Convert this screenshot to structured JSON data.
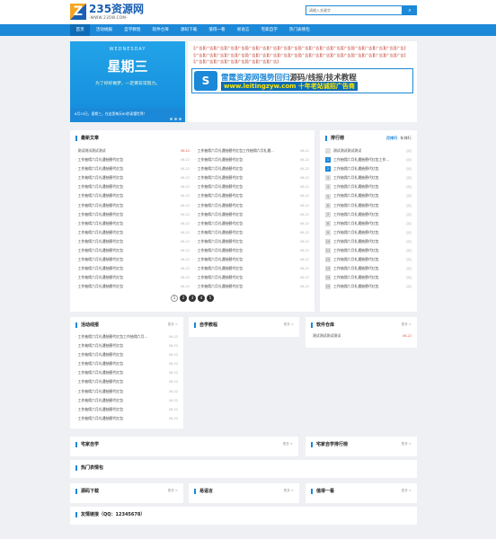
{
  "header": {
    "logo_mark": "Z",
    "logo_title": "235资源网",
    "logo_sub": "-WWW.235W.COM-",
    "search_placeholder": "请输入关键字",
    "search_icon": "search-icon",
    "search_glyph": "⌕"
  },
  "nav": [
    "首页",
    "活动线报",
    "自学教程",
    "软件仓库",
    "源码下载",
    "值得一看",
    "易语言",
    "宅家自学",
    "热门表情包"
  ],
  "hero": {
    "week_en": "WEDNESDAY",
    "day": "星期三",
    "tagline": "为了好好做梦，一定要非常努力。",
    "caption": "6月15日，星期三，在这里每天60秒读懂世界！"
  },
  "links": {
    "item": "【广告】",
    "count": 48
  },
  "ad": {
    "icon": "S",
    "line1_blue": "雷霆资源网强势回归",
    "line1_dark": "源码/线报/技术教程",
    "line2": "www.leitingzyw.com  十年老站诚招广告商"
  },
  "latest": {
    "title": "最新文章",
    "left": [
      {
        "t": "测试测试测试测试",
        "d": "06-22",
        "red": true
      },
      {
        "t": "工作抽佣六月礼遇抽替代红包",
        "d": "06-22"
      },
      {
        "t": "工作抽佣六月礼遇抽替代红包",
        "d": "06-22"
      },
      {
        "t": "工作抽佣六月礼遇抽替代红包",
        "d": "06-22"
      },
      {
        "t": "工作抽佣六月礼遇抽替代红包",
        "d": "06-22"
      },
      {
        "t": "工作抽佣六月礼遇抽替代红包",
        "d": "06-22"
      },
      {
        "t": "工作抽佣六月礼遇抽替代红包",
        "d": "06-22"
      },
      {
        "t": "工作抽佣六月礼遇抽替代红包",
        "d": "06-22"
      },
      {
        "t": "工作抽佣六月礼遇抽替代红包",
        "d": "06-22"
      },
      {
        "t": "工作抽佣六月礼遇抽替代红包",
        "d": "06-22"
      },
      {
        "t": "工作抽佣六月礼遇抽替代红包",
        "d": "06-22"
      },
      {
        "t": "工作抽佣六月礼遇抽替代红包",
        "d": "06-22"
      },
      {
        "t": "工作抽佣六月礼遇抽替代红包",
        "d": "06-22"
      },
      {
        "t": "工作抽佣六月礼遇抽替代红包",
        "d": "06-22"
      },
      {
        "t": "工作抽佣六月礼遇抽替代红包",
        "d": "06-22"
      },
      {
        "t": "工作抽佣六月礼遇抽替代红包",
        "d": "06-22"
      }
    ],
    "right": [
      {
        "t": "工作抽佣六月礼遇抽替代红包工作抽佣六月礼遇...",
        "d": "06-22"
      },
      {
        "t": "工作抽佣六月礼遇抽替代红包",
        "d": "06-22"
      },
      {
        "t": "工作抽佣六月礼遇抽替代红包",
        "d": "06-22"
      },
      {
        "t": "工作抽佣六月礼遇抽替代红包",
        "d": "06-22"
      },
      {
        "t": "工作抽佣六月礼遇抽替代红包",
        "d": "06-22"
      },
      {
        "t": "工作抽佣六月礼遇抽替代红包",
        "d": "06-22"
      },
      {
        "t": "工作抽佣六月礼遇抽替代红包",
        "d": "06-22"
      },
      {
        "t": "工作抽佣六月礼遇抽替代红包",
        "d": "06-22"
      },
      {
        "t": "工作抽佣六月礼遇抽替代红包",
        "d": "06-22"
      },
      {
        "t": "工作抽佣六月礼遇抽替代红包",
        "d": "06-22"
      },
      {
        "t": "工作抽佣六月礼遇抽替代红包",
        "d": "06-22"
      },
      {
        "t": "工作抽佣六月礼遇抽替代红包",
        "d": "06-22"
      },
      {
        "t": "工作抽佣六月礼遇抽替代红包",
        "d": "06-22"
      },
      {
        "t": "工作抽佣六月礼遇抽替代红包",
        "d": "06-22"
      },
      {
        "t": "工作抽佣六月礼遇抽替代红包",
        "d": "06-22"
      },
      {
        "t": "工作抽佣六月礼遇抽替代红包",
        "d": "06-22"
      }
    ],
    "pages": [
      "1",
      "2",
      "3",
      "4",
      "5"
    ]
  },
  "rank": {
    "title": "排行榜",
    "tabs": [
      "月排行",
      "年排行"
    ],
    "items": [
      "测试测试测试测试",
      "工作抽佣六月礼遇抽替代红包工作...",
      "工作抽佣六月礼遇抽替代红包",
      "工作抽佣六月礼遇抽替代红包",
      "工作抽佣六月礼遇抽替代红包",
      "工作抽佣六月礼遇抽替代红包",
      "工作抽佣六月礼遇抽替代红包",
      "工作抽佣六月礼遇抽替代红包",
      "工作抽佣六月礼遇抽替代红包",
      "工作抽佣六月礼遇抽替代红包",
      "工作抽佣六月礼遇抽替代红包",
      "工作抽佣六月礼遇抽替代红包",
      "工作抽佣六月礼遇抽替代红包",
      "工作抽佣六月礼遇抽替代红包",
      "工作抽佣六月礼遇抽替代红包",
      "工作抽佣六月礼遇抽替代红包"
    ],
    "tail": "[阅]"
  },
  "activity": {
    "title": "活动线报",
    "more": "更多 >",
    "items": [
      {
        "t": "工作抽佣六月礼遇抽替代红包工作抽佣六月...",
        "d": "06-22"
      },
      {
        "t": "工作抽佣六月礼遇抽替代红包",
        "d": "06-22"
      },
      {
        "t": "工作抽佣六月礼遇抽替代红包",
        "d": "06-22"
      },
      {
        "t": "工作抽佣六月礼遇抽替代红包",
        "d": "06-22"
      },
      {
        "t": "工作抽佣六月礼遇抽替代红包",
        "d": "06-22"
      },
      {
        "t": "工作抽佣六月礼遇抽替代红包",
        "d": "06-22"
      },
      {
        "t": "工作抽佣六月礼遇抽替代红包",
        "d": "06-22"
      },
      {
        "t": "工作抽佣六月礼遇抽替代红包",
        "d": "06-22"
      },
      {
        "t": "工作抽佣六月礼遇抽替代红包",
        "d": "06-22"
      },
      {
        "t": "工作抽佣六月礼遇抽替代红包",
        "d": "06-22"
      }
    ]
  },
  "study": {
    "title": "自学教程",
    "more": "更多 >"
  },
  "software": {
    "title": "软件仓库",
    "more": "更多 >",
    "item": "测试测试测试测试",
    "date": "06-22"
  },
  "zhaijia": {
    "title": "宅家自学",
    "more": "更多 >"
  },
  "zhaijia_rank": {
    "title": "宅家自学排行榜",
    "more": "更多 >"
  },
  "hot": {
    "title": "热门表情包"
  },
  "code": {
    "title": "源码下载",
    "more": "更多 >"
  },
  "yi": {
    "title": "易语言",
    "more": "更多 >"
  },
  "worth": {
    "title": "值得一看",
    "more": "更多 >"
  },
  "friend": {
    "title": "友情链接（QQ：12345678）"
  },
  "colors": {
    "primary": "#1b88d8",
    "nav_active": "#0d6cb5",
    "accent_red": "#e74c3c",
    "page_bg": "#eef0f3"
  }
}
